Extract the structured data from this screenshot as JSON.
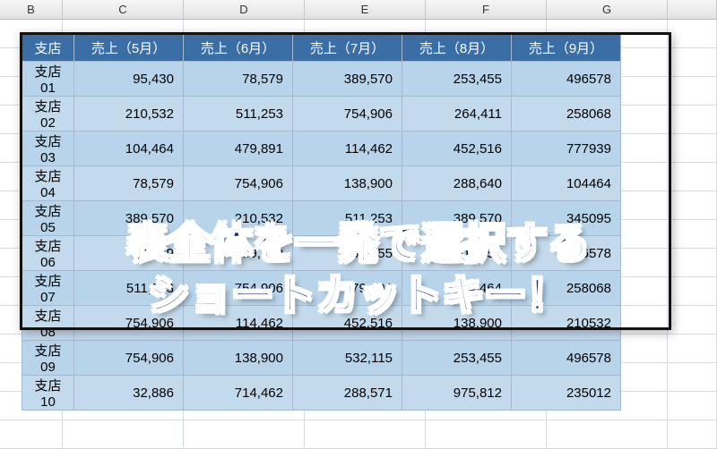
{
  "columns": [
    "B",
    "C",
    "D",
    "E",
    "F",
    "G"
  ],
  "headers": [
    "支店",
    "売上（5月）",
    "売上（6月）",
    "売上（7月）",
    "売上（8月）",
    "売上（9月）"
  ],
  "rows": [
    {
      "name": "支店01",
      "vals": [
        "95,430",
        "78,579",
        "389,570",
        "253,455",
        "496578"
      ]
    },
    {
      "name": "支店02",
      "vals": [
        "210,532",
        "511,253",
        "754,906",
        "264,411",
        "258068"
      ]
    },
    {
      "name": "支店03",
      "vals": [
        "104,464",
        "479,891",
        "114,462",
        "452,516",
        "777939"
      ]
    },
    {
      "name": "支店04",
      "vals": [
        "78,579",
        "754,906",
        "138,900",
        "288,640",
        "104464"
      ]
    },
    {
      "name": "支店05",
      "vals": [
        "389,570",
        "210,532",
        "511,253",
        "389,570",
        "345095"
      ]
    },
    {
      "name": "支店06",
      "vals": [
        "78,579",
        "389,570",
        "253,455",
        "609,557",
        "496578"
      ]
    },
    {
      "name": "支店07",
      "vals": [
        "511,253",
        "754,906",
        "479,891",
        "104,464",
        "258068"
      ]
    },
    {
      "name": "支店08",
      "vals": [
        "754,906",
        "114,462",
        "452,516",
        "138,900",
        "210532"
      ]
    },
    {
      "name": "支店09",
      "vals": [
        "754,906",
        "138,900",
        "532,115",
        "253,455",
        "496578"
      ]
    },
    {
      "name": "支店10",
      "vals": [
        "32,886",
        "714,462",
        "288,571",
        "975,812",
        "235012"
      ]
    }
  ],
  "overlay": {
    "line1": "表全体を一発で選択する",
    "line2": "ショートカットキー！"
  }
}
